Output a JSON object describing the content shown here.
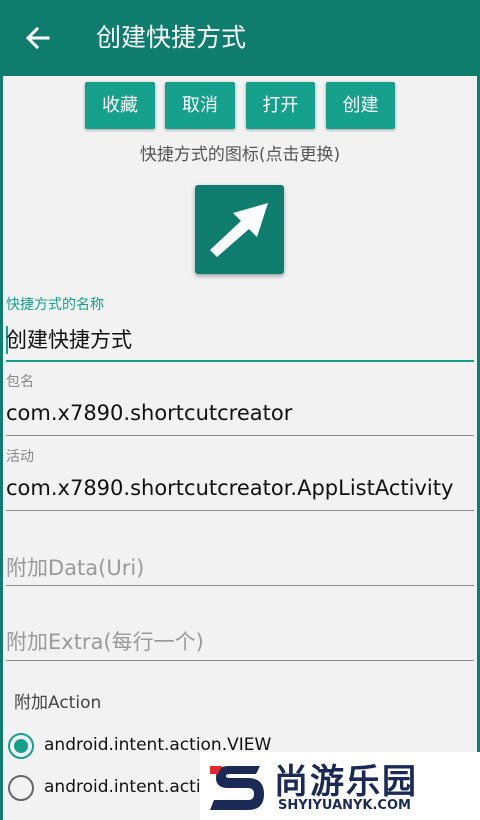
{
  "appbar": {
    "title": "创建快捷方式",
    "back_icon": "arrow-left-icon"
  },
  "actions": {
    "favorite": "收藏",
    "cancel": "取消",
    "open": "打开",
    "create": "创建"
  },
  "shortcut_icon": {
    "caption": "快捷方式的图标(点击更换)",
    "icon": "shortcut-arrow-icon"
  },
  "form": {
    "name": {
      "label": "快捷方式的名称",
      "value": "创建快捷方式"
    },
    "package": {
      "label": "包名",
      "value": "com.x7890.shortcutcreator"
    },
    "activity": {
      "label": "活动",
      "value": "com.x7890.shortcutcreator.AppListActivity"
    },
    "data_uri": {
      "placeholder": "附加Data(Uri)"
    },
    "extra": {
      "placeholder": "附加Extra(每行一个)"
    }
  },
  "action_section": {
    "label": "附加Action",
    "options": [
      {
        "label": "android.intent.action.VIEW",
        "selected": true
      },
      {
        "label": "android.intent.actio",
        "selected": false
      }
    ]
  },
  "watermark": {
    "title": "尚游乐园",
    "subtitle": "SHYIYUANYK.COM"
  },
  "colors": {
    "primary": "#0f7d6e",
    "accent": "#14a08a",
    "background": "#f2f2f2"
  }
}
